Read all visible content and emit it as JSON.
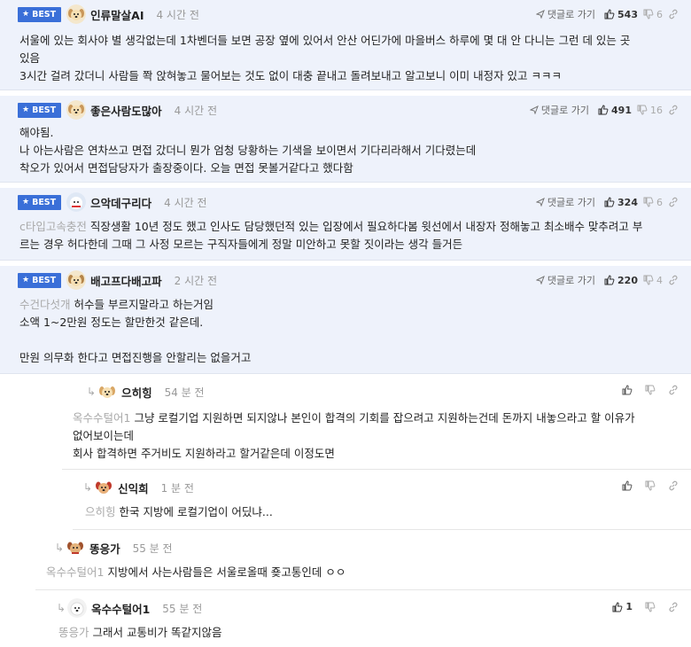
{
  "ui": {
    "best_label": "BEST",
    "goto_label": "댓글로 가기"
  },
  "comments": [
    {
      "nick": "인류말살AI",
      "time": "4 시간 전",
      "likes": "543",
      "dislikes": "6",
      "lines": [
        "서울에 있는 회사야 별 생각없는데 1차벤더들 보면 공장 옆에 있어서 안산 어딘가에 마을버스 하루에 몇 대 안 다니는 그런 데 있는 곳",
        "있음",
        "3시간 걸려 갔더니 사람들 쫙 앉혀놓고 물어보는 것도 없이 대충 끝내고 돌려보내고 알고보니 이미 내정자 있고 ㅋㅋㅋ"
      ]
    },
    {
      "nick": "좋은사람도많아",
      "time": "4 시간 전",
      "likes": "491",
      "dislikes": "16",
      "lines": [
        "해야됨.",
        "나 아는사람은 연차쓰고 면접 갔더니 뭔가 엄청 당황하는 기색을 보이면서 기다리라해서 기다렸는데",
        "착오가 있어서 면접담당자가 출장중이다. 오늘 면접 못볼거같다고 했다함"
      ]
    },
    {
      "nick": "으악데구리다",
      "time": "4 시간 전",
      "likes": "324",
      "dislikes": "6",
      "ref": "c타입고속충전",
      "lines": [
        "직장생활 10년 정도 했고 인사도 담당했던적 있는 입장에서 필요하다봄 윗선에서 내장자 정해놓고 최소배수 맞추려고 부",
        "르는 경우 허다한데 그때 그 사정 모르는 구직자들에게 정말 미안하고 못할 짓이라는 생각 들거든"
      ]
    },
    {
      "nick": "배고프다배고파",
      "time": "2 시간 전",
      "likes": "220",
      "dislikes": "4",
      "ref": "수건다섯개",
      "lines": [
        "허수들 부르지말라고 하는거임",
        "소액 1~2만원 정도는 할만한것 같은데.",
        "",
        "만원 의무화 한다고 면접진행을 안할리는 없을거고"
      ]
    },
    {
      "nick": "으히힝",
      "time": "54 분 전",
      "likes": "",
      "dislikes": "",
      "ref": "옥수수털어1",
      "lines": [
        "그냥 로컬기업 지원하면 되지않나 본인이 합격의 기회를 잡으려고 지원하는건데 돈까지 내놓으라고 할 이유가",
        "없어보이는데",
        "회사 합격하면 주거비도 지원하라고 할거같은데 이정도면"
      ]
    },
    {
      "nick": "신익희",
      "time": "1 분 전",
      "likes": "",
      "dislikes": "",
      "ref": "으히힝",
      "lines": [
        "한국 지방에 로컬기업이 어딨냐..."
      ]
    },
    {
      "nick": "똥응가",
      "time": "55 분 전",
      "likes": "",
      "dislikes": "",
      "ref": "옥수수털어1",
      "lines": [
        "지방에서 사는사람들은 서울로올때 죶고통인데 ㅇㅇ"
      ]
    },
    {
      "nick": "옥수수털어1",
      "time": "55 분 전",
      "likes": "1",
      "dislikes": "",
      "ref": "똥응가",
      "lines": [
        "그래서 교통비가 똑같지않음"
      ]
    }
  ],
  "icons": {
    "like": "thumbs-up-icon",
    "dislike": "thumbs-down-icon",
    "share": "link-icon",
    "goto": "send-arrow-icon",
    "reply": "reply-arrow-icon",
    "avatar": "dog-avatar-icon"
  }
}
